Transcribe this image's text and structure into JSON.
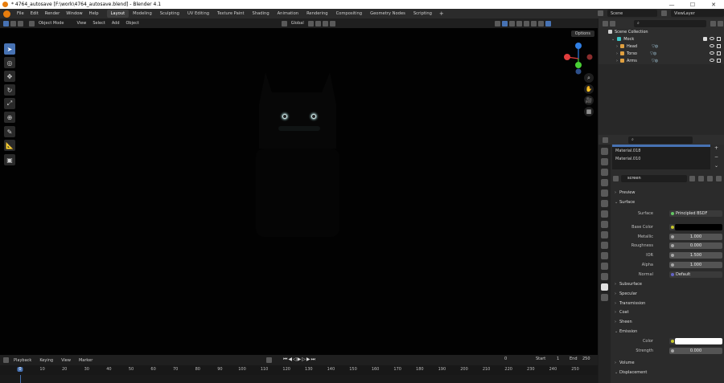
{
  "window": {
    "title": "* 4764_autosave [F:\\work\\4764_autosave.blend] - Blender 4.1",
    "min_icon": "—",
    "max_icon": "☐",
    "close_icon": "✕"
  },
  "menubar": {
    "items": [
      "File",
      "Edit",
      "Render",
      "Window",
      "Help"
    ],
    "workspaces": [
      "Layout",
      "Modeling",
      "Sculpting",
      "UV Editing",
      "Texture Paint",
      "Shading",
      "Animation",
      "Rendering",
      "Compositing",
      "Geometry Nodes",
      "Scripting"
    ],
    "active_workspace": "Layout",
    "add_workspace": "+",
    "scene": "Scene",
    "view_layer": "ViewLayer"
  },
  "viewport_header": {
    "mode": "Object Mode",
    "menus": [
      "View",
      "Select",
      "Add",
      "Object"
    ],
    "transform": "Global",
    "options": "Options"
  },
  "timeline": {
    "menus": [
      "Playback",
      "Keying",
      "View",
      "Marker"
    ],
    "current_frame": "0",
    "start_label": "Start",
    "start": "1",
    "end_label": "End",
    "end": "250",
    "ticks": [
      "0",
      "10",
      "20",
      "30",
      "40",
      "50",
      "60",
      "70",
      "80",
      "90",
      "100",
      "110",
      "120",
      "130",
      "140",
      "150",
      "160",
      "170",
      "180",
      "190",
      "200",
      "210",
      "220",
      "230",
      "240",
      "250"
    ]
  },
  "outliner": {
    "search_placeholder": "",
    "root": "Scene Collection",
    "collection": "Mock",
    "objects": [
      "Head",
      "Torso",
      "Arms"
    ]
  },
  "properties": {
    "search_placeholder": "",
    "materials": [
      "Material.018",
      "Material.010"
    ],
    "material_name": "screen",
    "panels": {
      "preview": "Preview",
      "surface": "Surface",
      "subsurface": "Subsurface",
      "specular": "Specular",
      "transmission": "Transmission",
      "coat": "Coat",
      "sheen": "Sheen",
      "emission": "Emission",
      "volume": "Volume",
      "displacement": "Displacement"
    },
    "surface": {
      "surface_label": "Surface",
      "surface_value": "Principled BSDF",
      "base_color_label": "Base Color",
      "base_color": "#000000",
      "metallic_label": "Metallic",
      "metallic": "1.000",
      "roughness_label": "Roughness",
      "roughness": "0.000",
      "ior_label": "IOR",
      "ior": "1.500",
      "alpha_label": "Alpha",
      "alpha": "1.000",
      "normal_label": "Normal",
      "normal": "Default"
    },
    "emission": {
      "color_label": "Color",
      "color": "#ffffff",
      "strength_label": "Strength",
      "strength": "0.000"
    }
  },
  "colors": {
    "accent": "#4772b3",
    "viewport_bg": "#020202",
    "gizmo_x": "#e13d3d",
    "gizmo_y": "#49cf35",
    "gizmo_z": "#2f7fe5"
  }
}
